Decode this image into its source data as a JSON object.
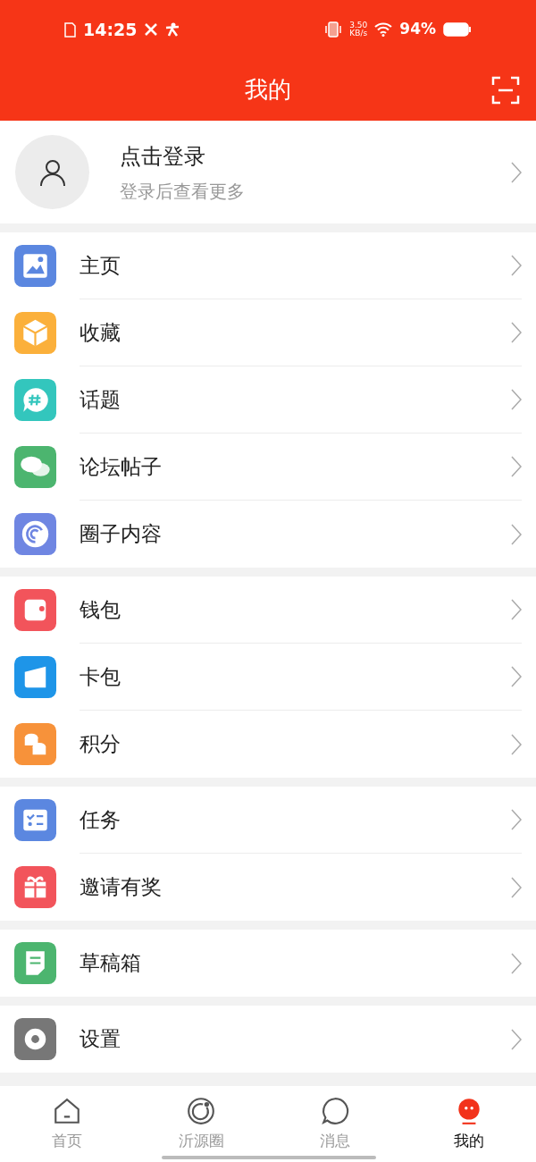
{
  "status_bar": {
    "time": "14:25",
    "speed_value": "3.50",
    "speed_unit": "KB/s",
    "battery": "94%"
  },
  "header": {
    "title": "我的"
  },
  "profile": {
    "name": "点击登录",
    "subtitle": "登录后查看更多"
  },
  "groups": [
    [
      {
        "label": "主页",
        "kind": "picture",
        "color": "#5b87e0"
      },
      {
        "label": "收藏",
        "kind": "cube",
        "color": "#fbb03b"
      },
      {
        "label": "话题",
        "kind": "hash",
        "color": "#33c6bd"
      },
      {
        "label": "论坛帖子",
        "kind": "chat",
        "color": "#4cb56f"
      },
      {
        "label": "圈子内容",
        "kind": "spiral",
        "color": "#6f86e2"
      }
    ],
    [
      {
        "label": "钱包",
        "kind": "wallet",
        "color": "#f2545b"
      },
      {
        "label": "卡包",
        "kind": "card",
        "color": "#1e95e8"
      },
      {
        "label": "积分",
        "kind": "coins",
        "color": "#f7923a"
      }
    ],
    [
      {
        "label": "任务",
        "kind": "tasks",
        "color": "#5b87e0"
      },
      {
        "label": "邀请有奖",
        "kind": "gift",
        "color": "#f2545b"
      }
    ],
    [
      {
        "label": "草稿箱",
        "kind": "draft",
        "color": "#4cb56f"
      }
    ],
    [
      {
        "label": "设置",
        "kind": "gear",
        "color": "#777777"
      }
    ]
  ],
  "tabs": [
    {
      "label": "首页",
      "kind": "home",
      "selected": false
    },
    {
      "label": "沂源圈",
      "kind": "circle",
      "selected": false
    },
    {
      "label": "消息",
      "kind": "message",
      "selected": false
    },
    {
      "label": "我的",
      "kind": "face",
      "selected": true
    }
  ]
}
